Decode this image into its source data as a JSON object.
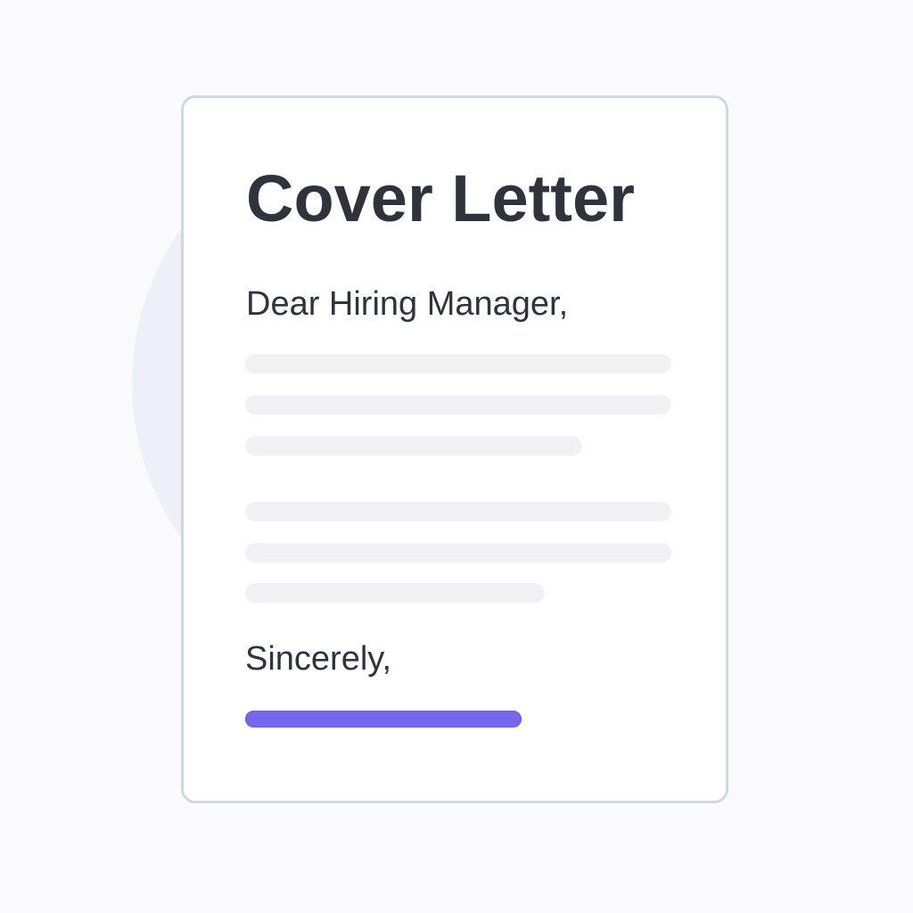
{
  "document": {
    "title": "Cover Letter",
    "greeting": "Dear Hiring Manager,",
    "paragraphs": [
      {
        "line_count": 3
      },
      {
        "line_count": 3
      }
    ],
    "closing": "Sincerely,"
  },
  "colors": {
    "background": "#fafafc",
    "circle": "#efeff9",
    "card": "#ffffff",
    "card_border": "#d3d6e2",
    "text": "#2f333b",
    "placeholder_line": "#f1f1f4",
    "signature_accent": "#7469ee"
  }
}
